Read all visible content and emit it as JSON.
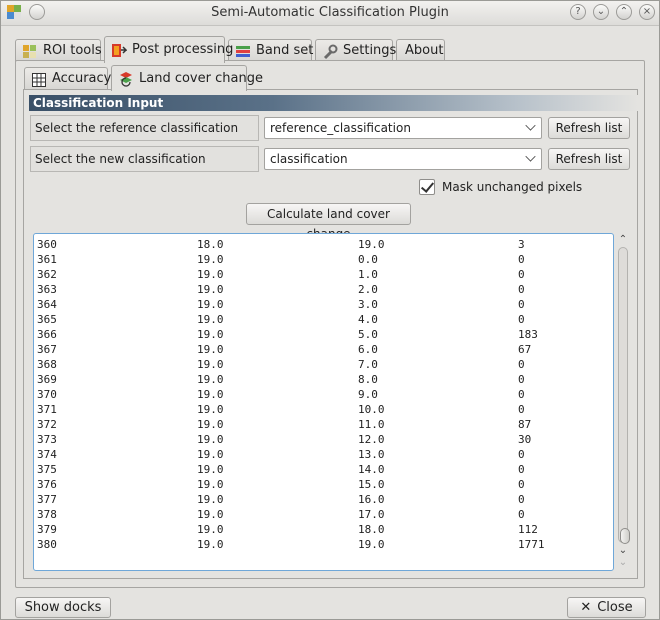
{
  "window": {
    "title": "Semi-Automatic Classification Plugin"
  },
  "tabs": [
    {
      "label": "ROI tools",
      "icon": "roi-icon"
    },
    {
      "label": "Post processing",
      "icon": "post-processing-icon"
    },
    {
      "label": "Band set",
      "icon": "band-set-icon"
    },
    {
      "label": "Settings",
      "icon": "wrench-icon"
    },
    {
      "label": "About"
    }
  ],
  "subtabs": [
    {
      "label": "Accuracy",
      "icon": "grid-icon"
    },
    {
      "label": "Land cover change",
      "icon": "land-cover-icon"
    }
  ],
  "section": {
    "title": "Classification Input"
  },
  "reference": {
    "label": "Select the reference classification",
    "value": "reference_classification",
    "refresh_label": "Refresh list"
  },
  "new_classification": {
    "label": "Select the new classification",
    "value": "classification",
    "refresh_label": "Refresh list"
  },
  "mask": {
    "label": "Mask unchanged pixels",
    "checked": true
  },
  "calculate_label": "Calculate land cover change",
  "output": {
    "rows": [
      [
        "360",
        "18.0",
        "19.0",
        "3"
      ],
      [
        "361",
        "19.0",
        "0.0",
        "0"
      ],
      [
        "362",
        "19.0",
        "1.0",
        "0"
      ],
      [
        "363",
        "19.0",
        "2.0",
        "0"
      ],
      [
        "364",
        "19.0",
        "3.0",
        "0"
      ],
      [
        "365",
        "19.0",
        "4.0",
        "0"
      ],
      [
        "366",
        "19.0",
        "5.0",
        "183"
      ],
      [
        "367",
        "19.0",
        "6.0",
        "67"
      ],
      [
        "368",
        "19.0",
        "7.0",
        "0"
      ],
      [
        "369",
        "19.0",
        "8.0",
        "0"
      ],
      [
        "370",
        "19.0",
        "9.0",
        "0"
      ],
      [
        "371",
        "19.0",
        "10.0",
        "0"
      ],
      [
        "372",
        "19.0",
        "11.0",
        "87"
      ],
      [
        "373",
        "19.0",
        "12.0",
        "30"
      ],
      [
        "374",
        "19.0",
        "13.0",
        "0"
      ],
      [
        "375",
        "19.0",
        "14.0",
        "0"
      ],
      [
        "376",
        "19.0",
        "15.0",
        "0"
      ],
      [
        "377",
        "19.0",
        "16.0",
        "0"
      ],
      [
        "378",
        "19.0",
        "17.0",
        "0"
      ],
      [
        "379",
        "19.0",
        "18.0",
        "112"
      ],
      [
        "380",
        "19.0",
        "19.0",
        "1771"
      ]
    ]
  },
  "footer": {
    "show_docks_label": "Show docks",
    "close_label": "Close"
  },
  "colors": {
    "header_dark": "#3a5067",
    "focus_border": "#6fa7d8"
  }
}
